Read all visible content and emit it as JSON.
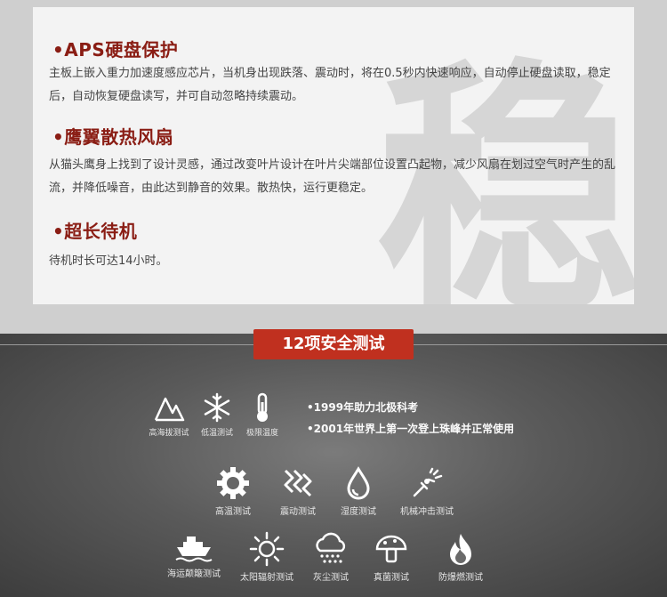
{
  "features": [
    {
      "title": "•APS硬盘保护",
      "desc": "主板上嵌入重力加速度感应芯片，当机身出现跌落、震动时，将在0.5秒内快速响应，自动停止硬盘读取，稳定后，自动恢复硬盘读写，并可自动忽略持续震动。"
    },
    {
      "title": "•鹰翼散热风扇",
      "desc": "从猫头鹰身上找到了设计灵感，通过改变叶片设计在叶片尖端部位设置凸起物，减少风扇在划过空气时产生的乱流，并降低噪音，由此达到静音的效果。散热快，运行更稳定。"
    },
    {
      "title": "•超长待机",
      "desc": "待机时长可达14小时。"
    }
  ],
  "watermark": "稳",
  "tests": {
    "badge": "12项安全测试",
    "row1": [
      {
        "icon": "mountain-icon",
        "label": "高海拔测试"
      },
      {
        "icon": "snowflake-icon",
        "label": "低温测试"
      },
      {
        "icon": "thermometer-icon",
        "label": "极限温度"
      }
    ],
    "facts": [
      "•1999年助力北极科考",
      "•2001年世界上第一次登上珠峰并正常使用"
    ],
    "row2": [
      {
        "icon": "gear-icon",
        "label": "高温测试"
      },
      {
        "icon": "vibration-icon",
        "label": "震动测试"
      },
      {
        "icon": "droplet-icon",
        "label": "湿度测试"
      },
      {
        "icon": "impact-icon",
        "label": "机械冲击测试"
      }
    ],
    "row3": [
      {
        "icon": "ship-icon",
        "label": "海运颠簸测试"
      },
      {
        "icon": "sun-icon",
        "label": "太阳辐射测试"
      },
      {
        "icon": "dust-cloud-icon",
        "label": "灰尘测试"
      },
      {
        "icon": "mushroom-icon",
        "label": "真菌测试"
      },
      {
        "icon": "flame-icon",
        "label": "防爆燃测试"
      }
    ]
  }
}
